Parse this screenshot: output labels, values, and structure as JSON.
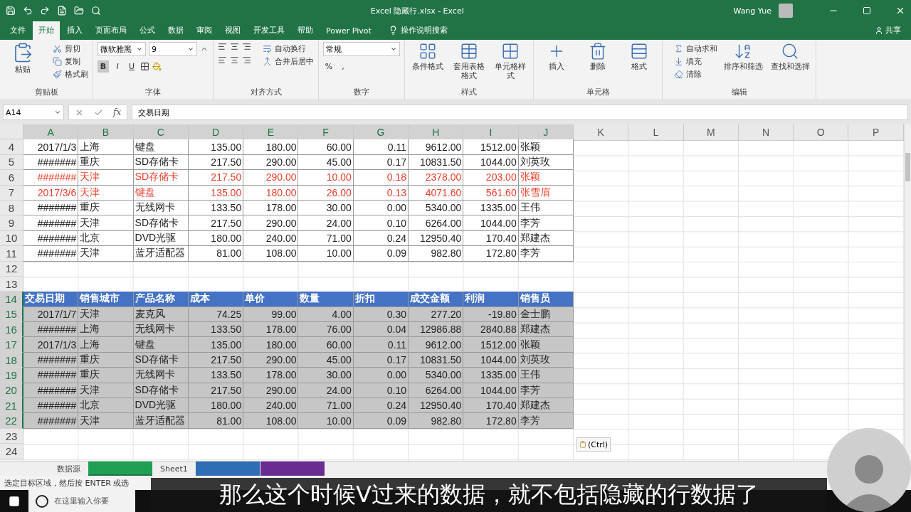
{
  "title_bar": {
    "title": "Excel 隐藏行.xlsx  -  Excel",
    "user": "Wang Yue"
  },
  "menu_tabs": [
    {
      "label": "文件",
      "selected": false
    },
    {
      "label": "开始",
      "selected": true
    },
    {
      "label": "插入",
      "selected": false
    },
    {
      "label": "页面布局",
      "selected": false
    },
    {
      "label": "公式",
      "selected": false
    },
    {
      "label": "数据",
      "selected": false
    },
    {
      "label": "审阅",
      "selected": false
    },
    {
      "label": "视图",
      "selected": false
    },
    {
      "label": "开发工具",
      "selected": false
    },
    {
      "label": "帮助",
      "selected": false
    },
    {
      "label": "Power Pivot",
      "selected": false
    }
  ],
  "tell_me": "操作说明搜索",
  "share": "共享",
  "ribbon": [
    {
      "label": "剪贴板",
      "items": [
        {
          "kind": "large",
          "label": "粘贴"
        },
        {
          "kind": "small",
          "label": "剪切"
        },
        {
          "kind": "small",
          "label": "复制"
        },
        {
          "kind": "small",
          "label": "格式刷"
        }
      ]
    },
    {
      "label": "字体",
      "items": [
        {
          "kind": "combo",
          "value": "微软雅黑"
        },
        {
          "kind": "combo",
          "value": "9"
        },
        {
          "kind": "toggle",
          "label": "B",
          "selected": true
        },
        {
          "kind": "toggle",
          "label": "I",
          "selected": false
        },
        {
          "kind": "toggle",
          "label": "U",
          "selected": false
        }
      ]
    },
    {
      "label": "对齐方式",
      "items": [
        {
          "kind": "small",
          "label": "自动换行"
        },
        {
          "kind": "small",
          "label": "合并后居中"
        }
      ]
    },
    {
      "label": "数字",
      "items": [
        {
          "kind": "combo",
          "value": "常规"
        },
        {
          "kind": "toggle",
          "label": "%",
          "selected": false
        },
        {
          "kind": "toggle",
          "label": ",",
          "selected": false
        }
      ]
    },
    {
      "label": "样式",
      "items": [
        {
          "kind": "large",
          "label": "条件格式"
        },
        {
          "kind": "large",
          "label": "套用表格格式"
        },
        {
          "kind": "large",
          "label": "单元格样式"
        }
      ]
    },
    {
      "label": "单元格",
      "items": [
        {
          "kind": "large",
          "label": "插入"
        },
        {
          "kind": "large",
          "label": "删除"
        },
        {
          "kind": "large",
          "label": "格式"
        }
      ]
    },
    {
      "label": "编辑",
      "items": [
        {
          "kind": "small",
          "label": "自动求和"
        },
        {
          "kind": "small",
          "label": "填充"
        },
        {
          "kind": "small",
          "label": "清除"
        },
        {
          "kind": "large",
          "label": "排序和筛选"
        },
        {
          "kind": "large",
          "label": "查找和选择"
        }
      ]
    }
  ],
  "formula_bar": {
    "name_box": "A14",
    "fx_label": "fx",
    "formula": "交易日期"
  },
  "sheet": {
    "columns": [
      {
        "label": "A",
        "selected": true
      },
      {
        "label": "B",
        "selected": true
      },
      {
        "label": "C",
        "selected": true
      },
      {
        "label": "D",
        "selected": true
      },
      {
        "label": "E",
        "selected": true
      },
      {
        "label": "F",
        "selected": true
      },
      {
        "label": "G",
        "selected": true
      },
      {
        "label": "H",
        "selected": true
      },
      {
        "label": "I",
        "selected": true
      },
      {
        "label": "J",
        "selected": true
      },
      {
        "label": "K",
        "selected": false
      },
      {
        "label": "L",
        "selected": false
      },
      {
        "label": "M",
        "selected": false
      },
      {
        "label": "N",
        "selected": false
      },
      {
        "label": "O",
        "selected": false
      },
      {
        "label": "P",
        "selected": false
      }
    ],
    "rows": [
      {
        "number": "4",
        "kind": "data",
        "selected": false,
        "alert": false,
        "cells": [
          "2017/1/3",
          "上海",
          "键盘",
          "135.00",
          "180.00",
          "60.00",
          "0.11",
          "9612.00",
          "1512.00",
          "张颖"
        ]
      },
      {
        "number": "5",
        "kind": "data",
        "selected": false,
        "alert": false,
        "cells": [
          "#######",
          "重庆",
          "SD存储卡",
          "217.50",
          "290.00",
          "45.00",
          "0.17",
          "10831.50",
          "1044.00",
          "刘英玫"
        ]
      },
      {
        "number": "6",
        "kind": "data",
        "selected": false,
        "alert": true,
        "cells": [
          "#######",
          "天津",
          "SD存储卡",
          "217.50",
          "290.00",
          "10.00",
          "0.18",
          "2378.00",
          "203.00",
          "张颖"
        ]
      },
      {
        "number": "7",
        "kind": "data",
        "selected": false,
        "alert": true,
        "cells": [
          "2017/3/6",
          "天津",
          "键盘",
          "135.00",
          "180.00",
          "26.00",
          "0.13",
          "4071.60",
          "561.60",
          "张雪眉"
        ]
      },
      {
        "number": "8",
        "kind": "data",
        "selected": false,
        "alert": false,
        "cells": [
          "#######",
          "重庆",
          "无线网卡",
          "133.50",
          "178.00",
          "30.00",
          "0.00",
          "5340.00",
          "1335.00",
          "王伟"
        ]
      },
      {
        "number": "9",
        "kind": "data",
        "selected": false,
        "alert": false,
        "cells": [
          "#######",
          "天津",
          "SD存储卡",
          "217.50",
          "290.00",
          "24.00",
          "0.10",
          "6264.00",
          "1044.00",
          "李芳"
        ]
      },
      {
        "number": "10",
        "kind": "data",
        "selected": false,
        "alert": false,
        "cells": [
          "#######",
          "北京",
          "DVD光驱",
          "180.00",
          "240.00",
          "71.00",
          "0.24",
          "12950.40",
          "170.40",
          "郑建杰"
        ]
      },
      {
        "number": "11",
        "kind": "data",
        "selected": false,
        "alert": false,
        "cells": [
          "#######",
          "天津",
          "蓝牙适配器",
          "81.00",
          "108.00",
          "10.00",
          "0.09",
          "982.80",
          "172.80",
          "李芳"
        ]
      },
      {
        "number": "12",
        "kind": "empty",
        "selected": false
      },
      {
        "number": "13",
        "kind": "empty",
        "selected": false
      },
      {
        "number": "14",
        "kind": "header",
        "selected": true,
        "cells": [
          "交易日期",
          "销售城市",
          "产品名称",
          "成本",
          "单价",
          "数量",
          "折扣",
          "成交金额",
          "利润",
          "销售员"
        ]
      },
      {
        "number": "15",
        "kind": "data",
        "selected": true,
        "alert": false,
        "cells": [
          "2017/1/7",
          "天津",
          "麦克风",
          "74.25",
          "99.00",
          "4.00",
          "0.30",
          "277.20",
          "-19.80",
          "金士鹏"
        ]
      },
      {
        "number": "16",
        "kind": "data",
        "selected": true,
        "alert": false,
        "cells": [
          "#######",
          "上海",
          "无线网卡",
          "133.50",
          "178.00",
          "76.00",
          "0.04",
          "12986.88",
          "2840.88",
          "郑建杰"
        ]
      },
      {
        "number": "17",
        "kind": "data",
        "selected": true,
        "alert": false,
        "cells": [
          "2017/1/3",
          "上海",
          "键盘",
          "135.00",
          "180.00",
          "60.00",
          "0.11",
          "9612.00",
          "1512.00",
          "张颖"
        ]
      },
      {
        "number": "18",
        "kind": "data",
        "selected": true,
        "alert": false,
        "cells": [
          "#######",
          "重庆",
          "SD存储卡",
          "217.50",
          "290.00",
          "45.00",
          "0.17",
          "10831.50",
          "1044.00",
          "刘英玫"
        ]
      },
      {
        "number": "19",
        "kind": "data",
        "selected": true,
        "alert": false,
        "cells": [
          "#######",
          "重庆",
          "无线网卡",
          "133.50",
          "178.00",
          "30.00",
          "0.00",
          "5340.00",
          "1335.00",
          "王伟"
        ]
      },
      {
        "number": "20",
        "kind": "data",
        "selected": true,
        "alert": false,
        "cells": [
          "#######",
          "天津",
          "SD存储卡",
          "217.50",
          "290.00",
          "24.00",
          "0.10",
          "6264.00",
          "1044.00",
          "李芳"
        ]
      },
      {
        "number": "21",
        "kind": "data",
        "selected": true,
        "alert": false,
        "cells": [
          "#######",
          "北京",
          "DVD光驱",
          "180.00",
          "240.00",
          "71.00",
          "0.24",
          "12950.40",
          "170.40",
          "郑建杰"
        ]
      },
      {
        "number": "22",
        "kind": "data",
        "selected": true,
        "alert": false,
        "cells": [
          "#######",
          "天津",
          "蓝牙适配器",
          "81.00",
          "108.00",
          "10.00",
          "0.09",
          "982.80",
          "172.80",
          "李芳"
        ]
      },
      {
        "number": "23",
        "kind": "empty",
        "selected": false
      },
      {
        "number": "24",
        "kind": "empty",
        "selected": false
      }
    ]
  },
  "paste_options": "(Ctrl)",
  "sheet_tabs": [
    {
      "label": "数据源",
      "selected": false
    },
    {
      "selected": true,
      "color": "#1fa052"
    },
    {
      "label": "Sheet1",
      "selected": false
    },
    {
      "selected": false,
      "color": "#2f6db5"
    },
    {
      "selected": false,
      "color": "#6a2c91"
    }
  ],
  "status_bar": "选定目标区域，然后按 ENTER 或选",
  "taskbar": {
    "search_placeholder": "在这里输入你要"
  },
  "subtitle": "那么这个时候V过来的数据，就不包括隐藏的行数据了"
}
